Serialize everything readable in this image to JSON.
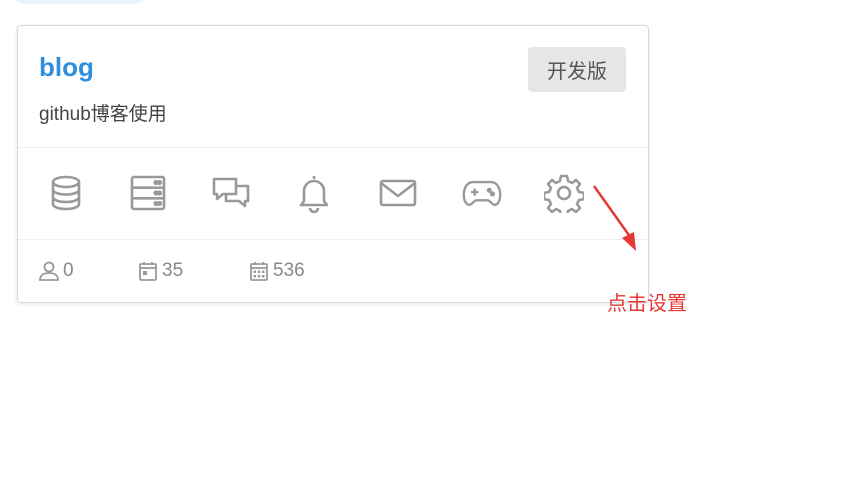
{
  "project": {
    "name": "blog",
    "edition": "开发版",
    "description": "github博客使用"
  },
  "toolbar_icons": [
    {
      "icon": "database-icon",
      "interactable": true
    },
    {
      "icon": "server-icon",
      "interactable": true
    },
    {
      "icon": "chat-icon",
      "interactable": true
    },
    {
      "icon": "bell-icon",
      "interactable": true
    },
    {
      "icon": "mail-icon",
      "interactable": true
    },
    {
      "icon": "gamepad-icon",
      "interactable": true
    },
    {
      "icon": "gear-icon",
      "interactable": true
    }
  ],
  "stats": {
    "users": "0",
    "calendar_a": "35",
    "calendar_b": "536"
  },
  "annotation": {
    "label": "点击设置",
    "color": "#e53935"
  },
  "colors": {
    "title": "#2f8fdd",
    "icon": "#999999"
  }
}
